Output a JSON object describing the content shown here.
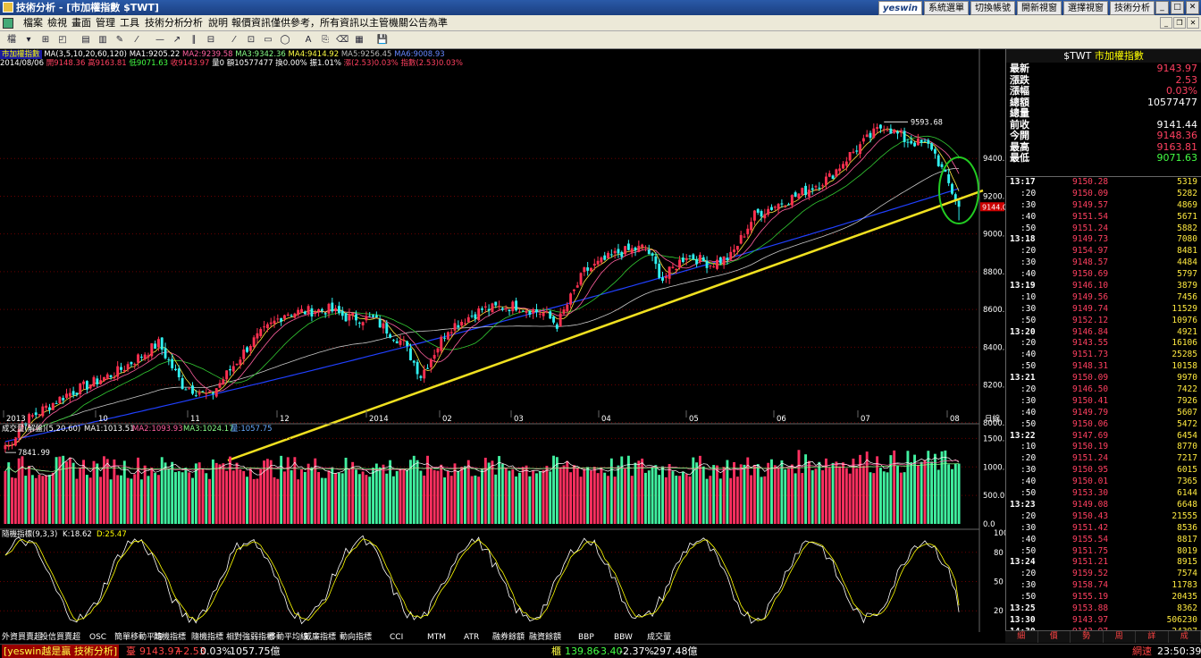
{
  "window": {
    "title": "技術分析 - [市加權指數 $TWT]"
  },
  "top_buttons": {
    "logo": "yeswin",
    "items": [
      "系統選單",
      "切換帳號",
      "開新視窗",
      "選擇視窗",
      "技術分析"
    ]
  },
  "menu": {
    "items": [
      "檔案",
      "檢視",
      "畫面",
      "管理",
      "工具",
      "技術分析",
      "分析",
      "說明",
      "報價資訊僅供參考，所有資訊以主管機關公告為準"
    ]
  },
  "toolbar": {
    "items": [
      "檔",
      "▾",
      "⊞",
      "◰",
      "▤",
      "▥",
      "✎",
      "⁄",
      "—",
      "↗",
      "∥",
      "⊟",
      "⁄",
      "⊡",
      "▭",
      "◯",
      "A",
      "⎘",
      "⌫",
      "▦",
      "💾"
    ]
  },
  "chart_header": {
    "name": "市加權指數",
    "ma": [
      "MA(3,5,10,20,60,120)",
      "MA1:9205.22",
      "MA2:9239.58",
      "MA3:9342.36",
      "MA4:9414.92",
      "MA5:9256.45",
      "MA6:9008.93"
    ],
    "date": "2014/08/06",
    "open": "開9148.36",
    "high": "高9163.81",
    "low": "低9071.63",
    "close": "收9143.97",
    "vol": "量0",
    "amount": "額10577477",
    "turn": "換0.00%",
    "amp": "振1.01%",
    "chg": "漲(2.53)0.03%",
    "idx": "指數(2.53)0.03%"
  },
  "price_axis": [
    "9400.0",
    "9200.0",
    "9000.0",
    "8800.0",
    "8600.0",
    "8400.0",
    "8200.0",
    "8000.0"
  ],
  "price_flag": "9144.0",
  "annot_high": "9593.68",
  "annot_low": "7841.99",
  "date_axis": [
    "2013",
    "10",
    "11",
    "12",
    "2014",
    "02",
    "03",
    "04",
    "05",
    "06",
    "07",
    "08"
  ],
  "date_axis_label": "日線",
  "volume_header": {
    "name": "成交量(解盤)(5,20,60)",
    "ma1": "MA1:1013.51",
    "ma2": "MA2:1093.93",
    "ma3": "MA3:1024.17",
    "vol": "量:1057.75"
  },
  "volume_axis": [
    "1500.0",
    "1000.0",
    "500.0",
    "0.0"
  ],
  "kd_header": {
    "name": "隨機指標(9,3,3)",
    "k": "K:18.62",
    "d": "D:25.47"
  },
  "kd_axis": [
    "100",
    "80",
    "50",
    "20"
  ],
  "quote": {
    "title_code": "$TWT",
    "title_name": "市加權指數",
    "rows": [
      {
        "label": "最新",
        "value": "9143.97",
        "color": "#ff4060"
      },
      {
        "label": "漲跌",
        "value": "2.53",
        "color": "#ff4060"
      },
      {
        "label": "漲幅",
        "value": "0.03%",
        "color": "#ff4060"
      },
      {
        "label": "總額",
        "value": "10577477",
        "color": "#ffffff"
      },
      {
        "label": "總量",
        "value": "",
        "color": "#ffffff"
      },
      {
        "label": "前收",
        "value": "9141.44",
        "color": "#ffffff"
      },
      {
        "label": "今開",
        "value": "9148.36",
        "color": "#ff4060"
      },
      {
        "label": "最高",
        "value": "9163.81",
        "color": "#ff4060"
      },
      {
        "label": "最低",
        "value": "9071.63",
        "color": "#4f4"
      }
    ]
  },
  "ticks": [
    {
      "t": "13:17",
      "p": "9150.28",
      "v": "5319",
      "main": true
    },
    {
      "t": ":20",
      "p": "9150.09",
      "v": "5282"
    },
    {
      "t": ":30",
      "p": "9149.57",
      "v": "4869"
    },
    {
      "t": ":40",
      "p": "9151.54",
      "v": "5671"
    },
    {
      "t": ":50",
      "p": "9151.24",
      "v": "5882"
    },
    {
      "t": "13:18",
      "p": "9149.73",
      "v": "7080",
      "main": true
    },
    {
      "t": ":20",
      "p": "9154.97",
      "v": "8481"
    },
    {
      "t": ":30",
      "p": "9148.57",
      "v": "4484"
    },
    {
      "t": ":40",
      "p": "9150.69",
      "v": "5797"
    },
    {
      "t": "13:19",
      "p": "9146.10",
      "v": "3879",
      "main": true
    },
    {
      "t": ":10",
      "p": "9149.56",
      "v": "7456"
    },
    {
      "t": ":30",
      "p": "9149.74",
      "v": "11529"
    },
    {
      "t": ":50",
      "p": "9152.12",
      "v": "10976"
    },
    {
      "t": "13:20",
      "p": "9146.84",
      "v": "4921",
      "main": true
    },
    {
      "t": ":20",
      "p": "9143.55",
      "v": "16106"
    },
    {
      "t": ":40",
      "p": "9151.73",
      "v": "25285"
    },
    {
      "t": ":50",
      "p": "9148.31",
      "v": "10158"
    },
    {
      "t": "13:21",
      "p": "9150.09",
      "v": "9970",
      "main": true
    },
    {
      "t": ":20",
      "p": "9146.50",
      "v": "7422"
    },
    {
      "t": ":30",
      "p": "9150.41",
      "v": "7926"
    },
    {
      "t": ":40",
      "p": "9149.79",
      "v": "5607"
    },
    {
      "t": ":50",
      "p": "9150.06",
      "v": "5472"
    },
    {
      "t": "13:22",
      "p": "9147.69",
      "v": "6454",
      "main": true
    },
    {
      "t": ":10",
      "p": "9150.19",
      "v": "8770"
    },
    {
      "t": ":20",
      "p": "9151.24",
      "v": "7217"
    },
    {
      "t": ":30",
      "p": "9150.95",
      "v": "6015"
    },
    {
      "t": ":40",
      "p": "9150.01",
      "v": "7365"
    },
    {
      "t": ":50",
      "p": "9153.30",
      "v": "6144"
    },
    {
      "t": "13:23",
      "p": "9149.08",
      "v": "6648",
      "main": true
    },
    {
      "t": ":20",
      "p": "9150.43",
      "v": "21555"
    },
    {
      "t": ":30",
      "p": "9151.42",
      "v": "8536"
    },
    {
      "t": ":40",
      "p": "9155.54",
      "v": "8817"
    },
    {
      "t": ":50",
      "p": "9151.75",
      "v": "8019"
    },
    {
      "t": "13:24",
      "p": "9151.21",
      "v": "8915",
      "main": true
    },
    {
      "t": ":20",
      "p": "9159.52",
      "v": "7574"
    },
    {
      "t": ":30",
      "p": "9158.74",
      "v": "11783"
    },
    {
      "t": ":50",
      "p": "9155.19",
      "v": "20435"
    },
    {
      "t": "13:25",
      "p": "9153.88",
      "v": "8362",
      "main": true
    },
    {
      "t": "13:30",
      "p": "9143.97",
      "v": "506230",
      "main": true
    },
    {
      "t": "14:30",
      "p": "9143.97",
      "v": "24397",
      "main": true
    }
  ],
  "right_tabs": [
    "細",
    "價",
    "勢",
    "周",
    "詳",
    "成"
  ],
  "bottom_tabs": [
    "外資買賣超",
    "投信買賣超",
    "OSC",
    "簡單移動平均",
    "隨機指標",
    "隨機指標",
    "相對強弱指標",
    "移動平均線",
    "威廉指標",
    "動向指標",
    "CCI",
    "MTM",
    "ATR",
    "融券餘額",
    "融資餘額",
    "BBP",
    "BBW",
    "成交量"
  ],
  "status": {
    "brand": "[yeswin越是贏 技術分析]",
    "idx1_label": "臺",
    "idx1": "9143.97",
    "idx1_chg": "+2.53",
    "idx1_pct": "0.03%",
    "idx1_vol": "1057.75億",
    "idx2_label": "櫃",
    "idx2": "139.86",
    "idx2_chg": "-3.40",
    "idx2_pct": "-2.37%",
    "idx2_vol": "297.48億",
    "conn": "網速",
    "time": "23:50:39"
  },
  "chart_data": [
    {
      "type": "candlestick",
      "title": "市加權指數",
      "ylim": [
        7800,
        9600
      ],
      "x_ticks": [
        "2013",
        "10",
        "11",
        "12",
        "2014",
        "02",
        "03",
        "04",
        "05",
        "06",
        "07",
        "08"
      ],
      "anchors": [
        [
          0,
          7842
        ],
        [
          5,
          8000
        ],
        [
          18,
          8150
        ],
        [
          33,
          8270
        ],
        [
          45,
          8420
        ],
        [
          52,
          8200
        ],
        [
          60,
          8140
        ],
        [
          72,
          8420
        ],
        [
          82,
          8580
        ],
        [
          95,
          8600
        ],
        [
          100,
          8560
        ],
        [
          108,
          8550
        ],
        [
          117,
          8420
        ],
        [
          122,
          8250
        ],
        [
          130,
          8500
        ],
        [
          140,
          8600
        ],
        [
          150,
          8620
        ],
        [
          158,
          8580
        ],
        [
          162,
          8520
        ],
        [
          170,
          8800
        ],
        [
          180,
          8900
        ],
        [
          188,
          8930
        ],
        [
          193,
          8760
        ],
        [
          200,
          8890
        ],
        [
          207,
          8840
        ],
        [
          213,
          8880
        ],
        [
          220,
          9100
        ],
        [
          232,
          9200
        ],
        [
          242,
          9300
        ],
        [
          248,
          9420
        ],
        [
          258,
          9580
        ],
        [
          264,
          9500
        ],
        [
          272,
          9460
        ],
        [
          280,
          9144
        ]
      ],
      "last": {
        "open": 9148.36,
        "high": 9163.81,
        "low": 9071.63,
        "close": 9143.97
      },
      "annotations": [
        {
          "label": "9593.68",
          "value": 9593.68
        },
        {
          "label": "7841.99",
          "value": 7841.99
        }
      ]
    },
    {
      "type": "bar",
      "title": "成交量(解盤)(5,20,60)",
      "ylim": [
        0,
        1600
      ],
      "mean": 1000
    },
    {
      "type": "line",
      "title": "隨機指標(9,3,3)",
      "ylim": [
        0,
        100
      ],
      "series": [
        {
          "name": "K",
          "last": 18.62
        },
        {
          "name": "D",
          "last": 25.47
        }
      ]
    }
  ]
}
